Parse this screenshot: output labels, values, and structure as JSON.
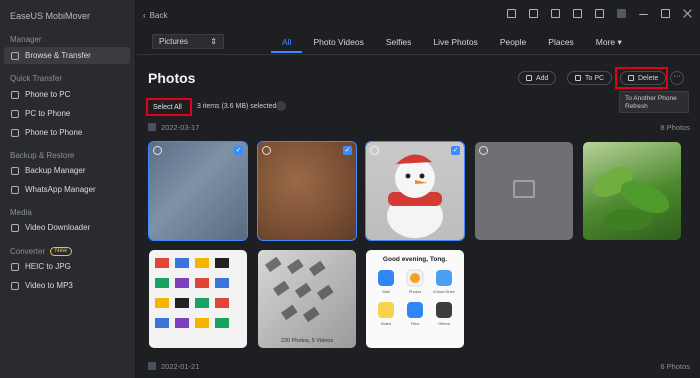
{
  "app": {
    "title": "EaseUS MobiMover"
  },
  "sidebar": {
    "sections": [
      {
        "label": "Manager",
        "items": [
          {
            "label": "Browse & Transfer",
            "icon": "folder-icon"
          }
        ]
      },
      {
        "label": "Quick Transfer",
        "items": [
          {
            "label": "Phone to PC",
            "icon": "phone-icon"
          },
          {
            "label": "PC to Phone",
            "icon": "pc-icon"
          },
          {
            "label": "Phone to Phone",
            "icon": "phones-icon"
          }
        ]
      },
      {
        "label": "Backup & Restore",
        "items": [
          {
            "label": "Backup Manager",
            "icon": "backup-icon"
          },
          {
            "label": "WhatsApp Manager",
            "icon": "whatsapp-icon"
          }
        ]
      },
      {
        "label": "Media",
        "items": [
          {
            "label": "Video Downloader",
            "icon": "download-icon"
          }
        ]
      },
      {
        "label": "Converter",
        "badge": "New",
        "items": [
          {
            "label": "HEIC to JPG",
            "icon": "image-convert-icon"
          },
          {
            "label": "Video to MP3",
            "icon": "music-icon"
          }
        ]
      }
    ]
  },
  "header": {
    "back_label": "Back"
  },
  "toolbar": {
    "category": "Pictures",
    "tabs": [
      "All",
      "Photo Videos",
      "Selfies",
      "Live Photos",
      "People",
      "Places",
      "More"
    ],
    "active_tab": "All"
  },
  "content": {
    "title": "Photos",
    "add_label": "Add",
    "to_pc_label": "To PC",
    "delete_label": "Delete",
    "more_label": "···",
    "dropdown_label": "To Another Phone Refresh",
    "select_all_label": "Select All",
    "selected_info": "3 items (3.6 MB) selected",
    "groups": [
      {
        "date": "2022-03-17",
        "count": "8 Photos"
      },
      {
        "date": "2022-01-21",
        "count": "6 Photos"
      }
    ],
    "thumb_captions": {
      "keys": "220 Photos, 5 Videos",
      "phone_greeting": "Good evening, Tong.",
      "share_labels": [
        "Mail",
        "Photos",
        "iCloud Drive",
        "Notes",
        "Files",
        "Others"
      ]
    }
  },
  "colors": {
    "accent": "#3d8bff",
    "highlight": "#e4001b",
    "sidebar_bg": "#2a2b30",
    "main_bg": "#1e1f23"
  }
}
